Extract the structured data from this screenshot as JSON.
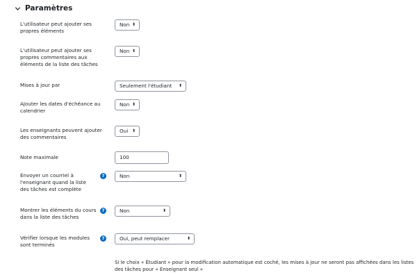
{
  "section": {
    "title": "Paramètres",
    "expanded_icon": "chevron-down-icon"
  },
  "fields": [
    {
      "label": "L'utilisateur peut ajouter ses propres éléments",
      "value": "Non",
      "help": false
    },
    {
      "label": "L'utilisateur peut ajouter ses propres commentaires aux éléments de la liste des tâches",
      "value": "Non",
      "help": false
    },
    {
      "label": "Mises à jour par",
      "value": "Seulement l'étudiant",
      "help": false
    },
    {
      "label": "Ajouter les dates d'échéance au calendrier",
      "value": "Non",
      "help": false
    },
    {
      "label": "Les enseignants peuvent ajouter des commentaires",
      "value": "Oui",
      "help": false
    },
    {
      "label": "Note maximale",
      "value": "100",
      "help": false
    },
    {
      "label": "Envoyer un courriel à l'enseignant quand la liste des tâches est complète",
      "value": "Non",
      "help": true
    },
    {
      "label": "Montrer les éléments du cours dans la liste des tâches",
      "value": "Non",
      "help": true
    },
    {
      "label": "Vérifier lorsque les modules sont terminés",
      "value": "Oui, peut remplacer",
      "help": true
    }
  ],
  "help_glyph": "?",
  "select_arrow_glyph": "⬍",
  "note": "Si le choix « Étudiant » pour la modification automatique est coché, les mises à jour ne seront pas affichées dans les listes des tâches pour « Enseignant seul »",
  "colors": {
    "accent": "#0f6cbf",
    "border": "#8f959e",
    "text": "#1d2125"
  }
}
